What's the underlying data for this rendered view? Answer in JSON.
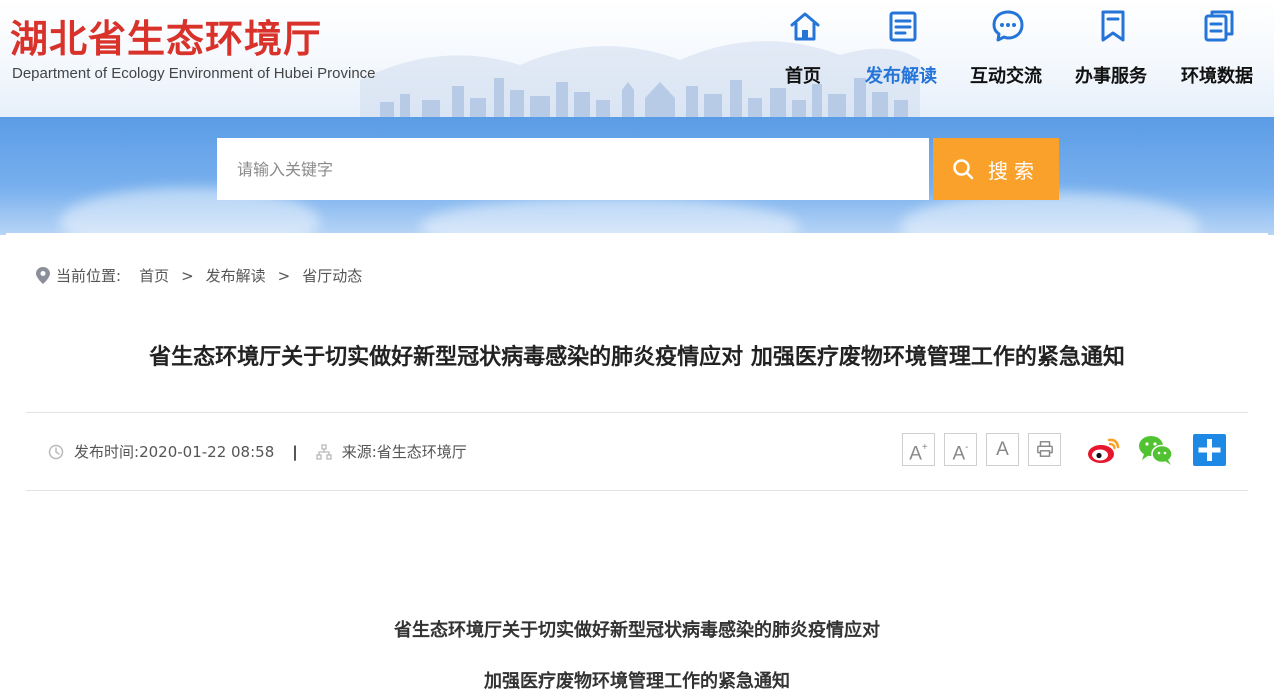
{
  "header": {
    "logo_title": "湖北省生态环境厅",
    "logo_subtitle": "Department of Ecology Environment of Hubei Province",
    "nav": [
      {
        "label": "首页",
        "icon": "home-icon",
        "active": false
      },
      {
        "label": "发布解读",
        "icon": "document-icon",
        "active": true
      },
      {
        "label": "互动交流",
        "icon": "chat-bubble-icon",
        "active": false
      },
      {
        "label": "办事服务",
        "icon": "bookmark-icon",
        "active": false
      },
      {
        "label": "环境数据",
        "icon": "data-pages-icon",
        "active": false
      }
    ]
  },
  "search": {
    "placeholder": "请输入关键字",
    "button_label": "搜索"
  },
  "breadcrumb": {
    "label": "当前位置:",
    "items": [
      "首页",
      "发布解读",
      "省厅动态"
    ],
    "separator": ">"
  },
  "article": {
    "title": "省生态环境厅关于切实做好新型冠状病毒感染的肺炎疫情应对 加强医疗废物环境管理工作的紧急通知",
    "publish_label": "发布时间:",
    "publish_time": "2020-01-22 08:58",
    "meta_separator": "|",
    "source_label": "来源:",
    "source": "省生态环境厅",
    "body_heading_line1": "省生态环境厅关于切实做好新型冠状病毒感染的肺炎疫情应对",
    "body_heading_line2": "加强医疗废物环境管理工作的紧急通知"
  },
  "tools": {
    "font_increase": "A",
    "font_decrease": "A",
    "font_reset": "A",
    "plus_sign": "+",
    "minus_sign": "-"
  },
  "colors": {
    "brand_red": "#d9322b",
    "nav_active": "#2575d8",
    "search_button": "#f9a12a",
    "search_band": "#6aa6ea"
  }
}
